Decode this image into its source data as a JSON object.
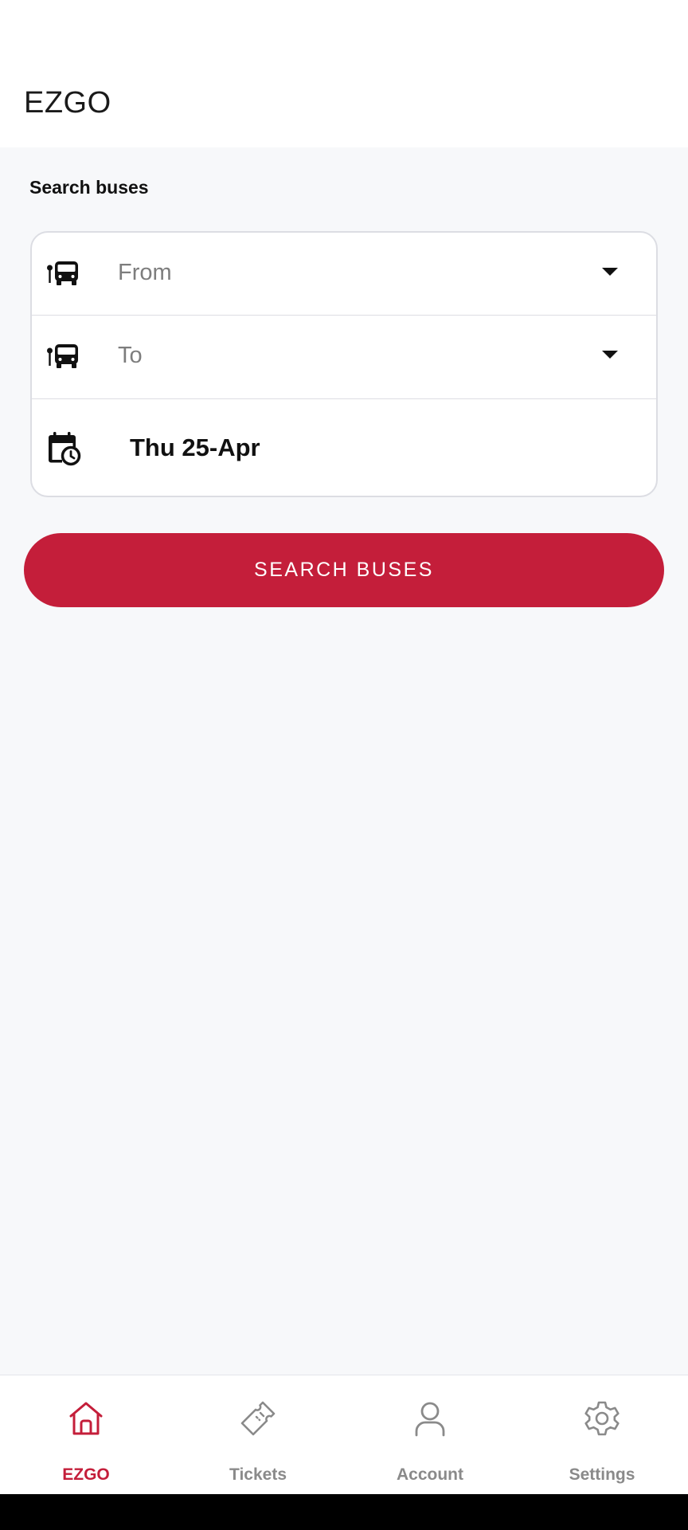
{
  "app": {
    "title": "EZGO"
  },
  "search": {
    "section_title": "Search buses",
    "from_placeholder": "From",
    "to_placeholder": "To",
    "date": "Thu 25-Apr",
    "button_label": "SEARCH BUSES"
  },
  "icons": {
    "from": "bus-stop-icon",
    "to": "bus-stop-icon",
    "date": "calendar-clock-icon",
    "dropdown": "caret-down-icon"
  },
  "bottom_nav": {
    "items": [
      {
        "label": "EZGO",
        "icon": "home-icon",
        "active": true
      },
      {
        "label": "Tickets",
        "icon": "ticket-icon",
        "active": false
      },
      {
        "label": "Account",
        "icon": "person-icon",
        "active": false
      },
      {
        "label": "Settings",
        "icon": "gear-icon",
        "active": false
      }
    ]
  },
  "colors": {
    "accent": "#c41e3a",
    "background": "#f7f8fa",
    "nav_inactive": "#8a8a8a"
  }
}
